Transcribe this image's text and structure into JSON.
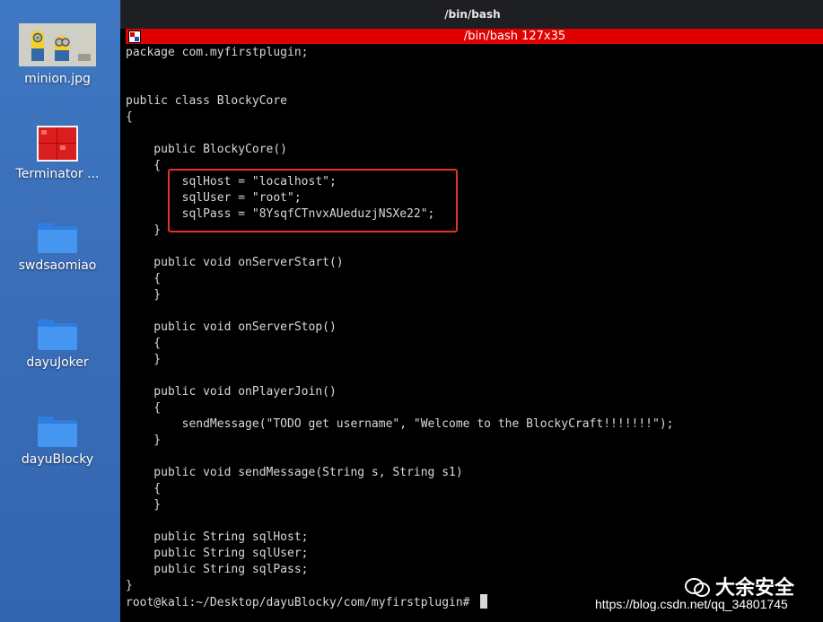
{
  "desktop": {
    "icons": [
      {
        "label": "minion.jpg",
        "icon": "image-thumbnail-icon"
      },
      {
        "label": "Terminator ...",
        "icon": "terminator-app-icon"
      },
      {
        "label": "swdsaomiao",
        "icon": "folder-icon"
      },
      {
        "label": "dayuJoker",
        "icon": "folder-icon"
      },
      {
        "label": "dayuBlocky",
        "icon": "folder-icon"
      }
    ]
  },
  "window": {
    "title": "/bin/bash",
    "tab_title": "/bin/bash 127x35"
  },
  "terminal": {
    "lines": [
      "package com.myfirstplugin;",
      "",
      "",
      "public class BlockyCore",
      "{",
      "",
      "    public BlockyCore()",
      "    {",
      "        sqlHost = \"localhost\";",
      "        sqlUser = \"root\";",
      "        sqlPass = \"8YsqfCTnvxAUeduzjNSXe22\";",
      "    }",
      "",
      "    public void onServerStart()",
      "    {",
      "    }",
      "",
      "    public void onServerStop()",
      "    {",
      "    }",
      "",
      "    public void onPlayerJoin()",
      "    {",
      "        sendMessage(\"TODO get username\", \"Welcome to the BlockyCraft!!!!!!!\");",
      "    }",
      "",
      "    public void sendMessage(String s, String s1)",
      "    {",
      "    }",
      "",
      "    public String sqlHost;",
      "    public String sqlUser;",
      "    public String sqlPass;",
      "}"
    ],
    "prompt": "root@kali:~/Desktop/dayuBlocky/com/myfirstplugin# "
  },
  "overlay": {
    "watermark_text": "大余安全",
    "url": "https://blog.csdn.net/qq_34801745"
  },
  "colors": {
    "highlight_box": "#e53030",
    "tab_bar": "#e00000",
    "terminal_bg": "#000000",
    "terminal_fg": "#d8d8d8"
  }
}
